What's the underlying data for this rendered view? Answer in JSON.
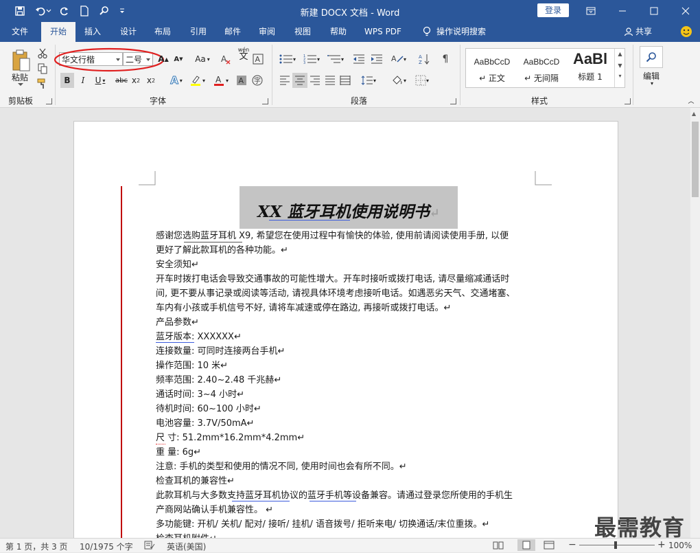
{
  "titlebar": {
    "title": "新建 DOCX 文档  -  Word",
    "login": "登录"
  },
  "menu": {
    "tabs": [
      "文件",
      "开始",
      "插入",
      "设计",
      "布局",
      "引用",
      "邮件",
      "审阅",
      "视图",
      "帮助",
      "WPS PDF"
    ],
    "tell_me": "操作说明搜索",
    "share": "共享"
  },
  "ribbon": {
    "clipboard": {
      "paste_label": "粘贴",
      "group_label": "剪贴板"
    },
    "font": {
      "font_name": "华文行楷",
      "font_size": "二号",
      "group_label": "字体",
      "case_label": "Aa",
      "wen_label": "wén"
    },
    "paragraph": {
      "group_label": "段落"
    },
    "styles": {
      "group_label": "样式",
      "items": [
        {
          "preview": "AaBbCcD",
          "name": "↵ 正文"
        },
        {
          "preview": "AaBbCcD",
          "name": "↵ 无间隔"
        },
        {
          "preview": "AaBl",
          "name": "标题 1"
        }
      ]
    },
    "editing": {
      "label": "编辑"
    }
  },
  "document": {
    "title": "XX 蓝牙耳机使用说明书",
    "lines": [
      "感谢您选购蓝牙耳机 X9, 希望您在使用过程中有愉快的体验, 使用前请阅读使用手册, 以便",
      "更好了解此款耳机的各种功能。↵",
      "安全须知↵",
      "开车时拨打电话会导致交通事故的可能性增大。开车时接听或拨打电话, 请尽量缩减通话时",
      "间, 更不要从事记录或阅读等活动, 请视具体环境考虑接听电话。如遇恶劣天气、交通堵塞、",
      "车内有小孩或手机信号不好, 请将车减速或停在路边, 再接听或拨打电话。↵",
      "产品参数↵",
      "蓝牙版本: XXXXXX↵",
      "连接数量: 可同时连接两台手机↵",
      "操作范围: 10 米↵",
      "频率范围: 2.40~2.48 千兆赫↵",
      "通话时间: 3~4 小时↵",
      "待机时间: 60~100 小时↵",
      "电池容量: 3.7V/50mA↵",
      "尺      寸: 51.2mm*16.2mm*4.2mm↵",
      "重      量: 6g↵",
      "注意: 手机的类型和使用的情况不同, 使用时间也会有所不同。↵",
      "检查耳机的兼容性↵",
      "此款耳机与大多数支持蓝牙耳机协议的蓝牙手机等设备兼容。请通过登录您所使用的手机生",
      "产商网站确认手机兼容性。 ↵",
      "多功能键: 开机/ 关机/ 配对/ 接听/ 挂机/ 语音拨号/ 拒听来电/ 切换通话/末位重拨。↵",
      "检查耳机附件↵"
    ]
  },
  "status": {
    "page": "第 1 页，共 3 页",
    "words": "10/1975 个字",
    "lang": "英语(美国)",
    "zoom": "100%"
  },
  "watermark": "最需教育",
  "colors": {
    "accent": "#2b579a",
    "annotation": "#e02020"
  }
}
